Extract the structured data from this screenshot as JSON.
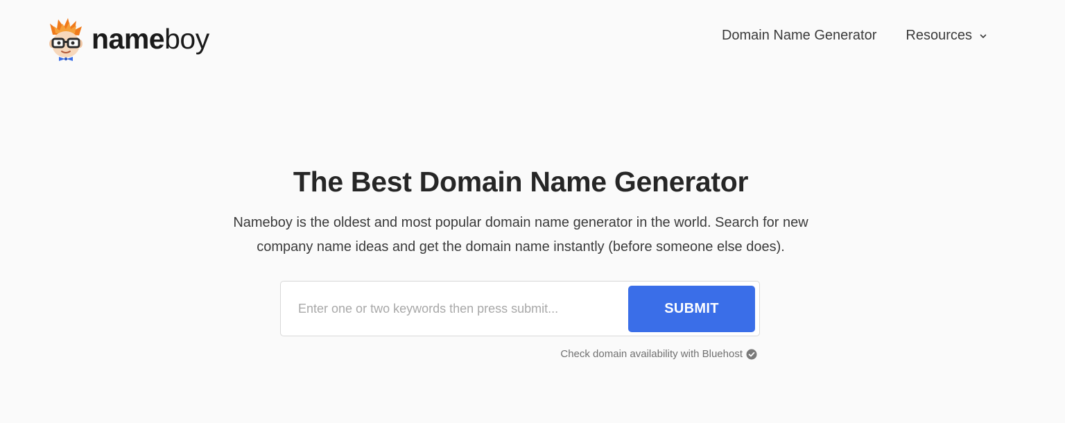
{
  "header": {
    "logo": {
      "name_bold": "name",
      "name_light": "boy",
      "icon": "nerd-mascot-icon"
    },
    "nav": {
      "items": [
        {
          "label": "Domain Name Generator"
        },
        {
          "label": "Resources",
          "icon": "chevron-down-icon"
        }
      ]
    }
  },
  "hero": {
    "title": "The Best Domain Name Generator",
    "description": "Nameboy is the oldest and most popular domain name generator in the world. Search for new company name ideas and get the domain name instantly (before someone else does)."
  },
  "search": {
    "value": "",
    "placeholder": "Enter one or two keywords then press submit...",
    "submit_label": "SUBMIT"
  },
  "availability": {
    "text": "Check domain availability with Bluehost",
    "icon": "check-circle-icon"
  },
  "colors": {
    "background": "#fafafa",
    "accent": "#3a6ee8",
    "text": "#262626",
    "muted": "#707070"
  }
}
